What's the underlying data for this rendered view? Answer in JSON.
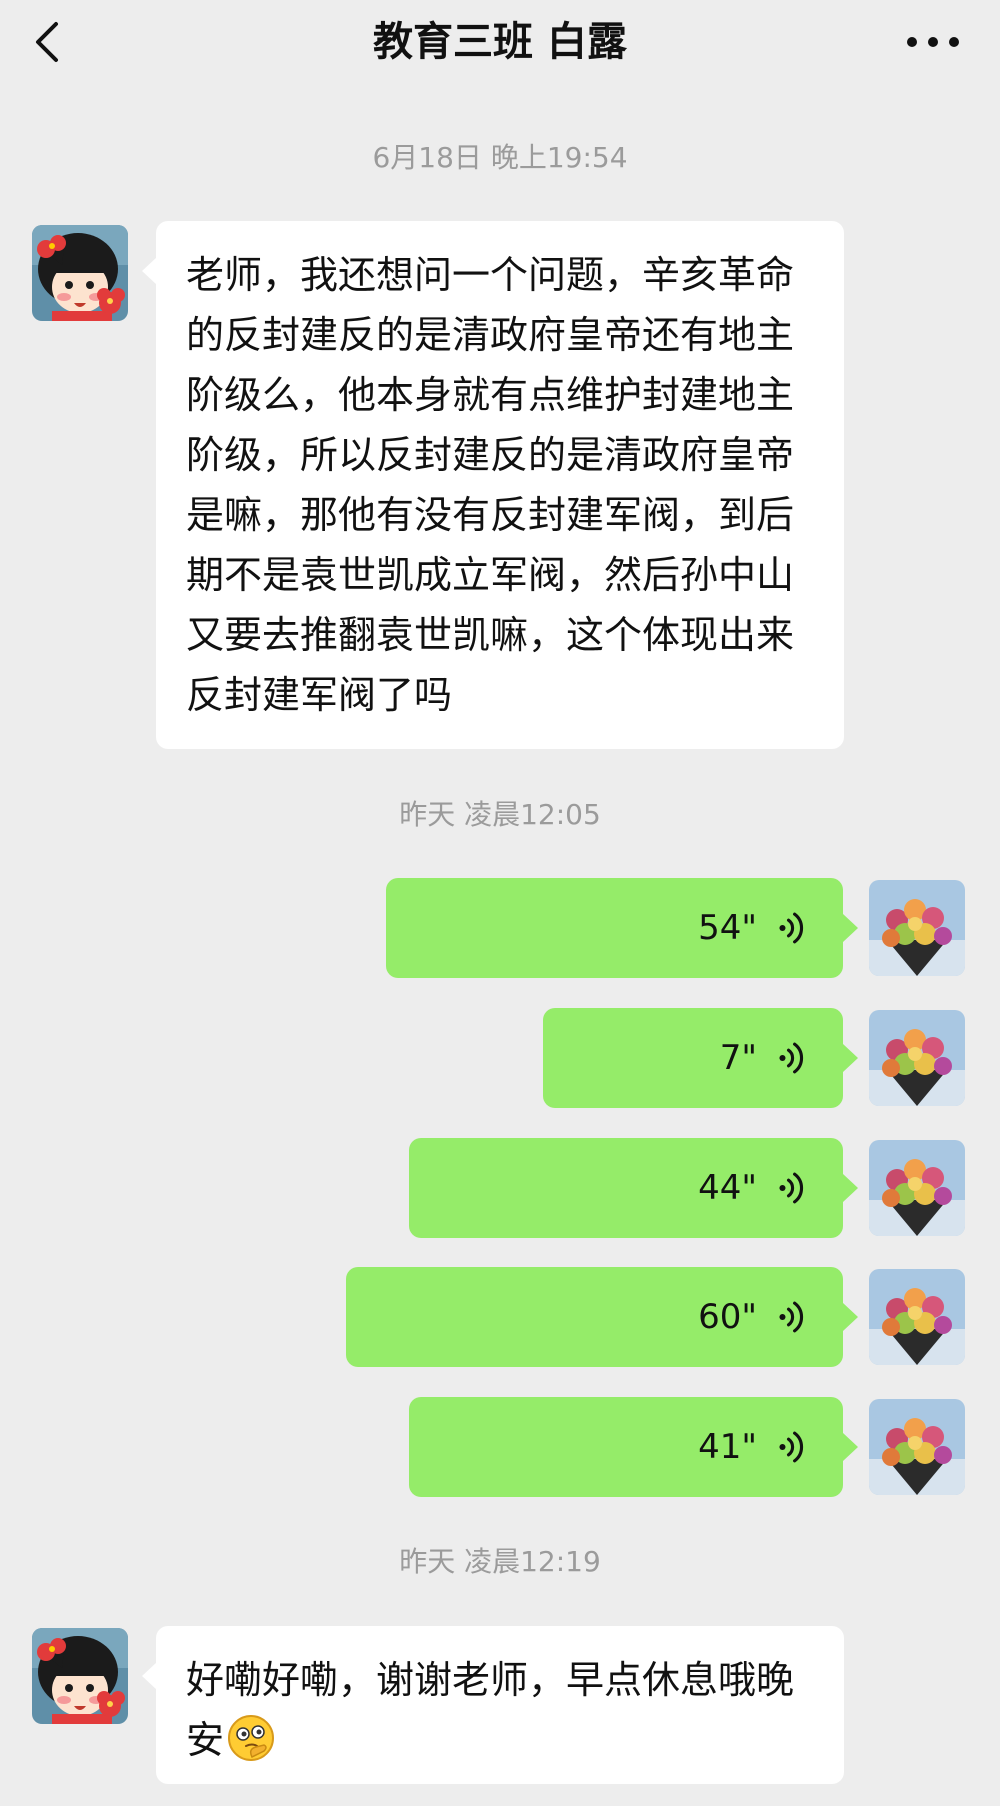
{
  "header": {
    "title": "教育三班 白露",
    "back_icon": "chevron-left-icon",
    "more_icon": "ellipsis-icon"
  },
  "timestamps": [
    "6月18日 晚上19:54",
    "昨天 凌晨12:05",
    "昨天 凌晨12:19"
  ],
  "messages": {
    "first": {
      "sender": "contact",
      "text": "老师，我还想问一个问题，辛亥革命的反封建反的是清政府皇帝还有地主阶级么，他本身就有点维护封建地主阶级，所以反封建反的是清政府皇帝是嘛，那他有没有反封建军阀，到后期不是袁世凯成立军阀，然后孙中山又要去推翻袁世凯嘛，这个体现出来反封建军阀了吗"
    },
    "voices": [
      {
        "sender": "me",
        "duration": "54\""
      },
      {
        "sender": "me",
        "duration": "7\""
      },
      {
        "sender": "me",
        "duration": "44\""
      },
      {
        "sender": "me",
        "duration": "60\""
      },
      {
        "sender": "me",
        "duration": "41\""
      }
    ],
    "last": {
      "sender": "contact",
      "text": "好嘞好嘞，谢谢老师，早点休息哦晚安",
      "emoji": "thinking-face-emoji"
    }
  },
  "colors": {
    "background": "#ededed",
    "incoming_bubble": "#ffffff",
    "outgoing_bubble": "#95ec69",
    "timestamp": "#9b9b9b"
  }
}
